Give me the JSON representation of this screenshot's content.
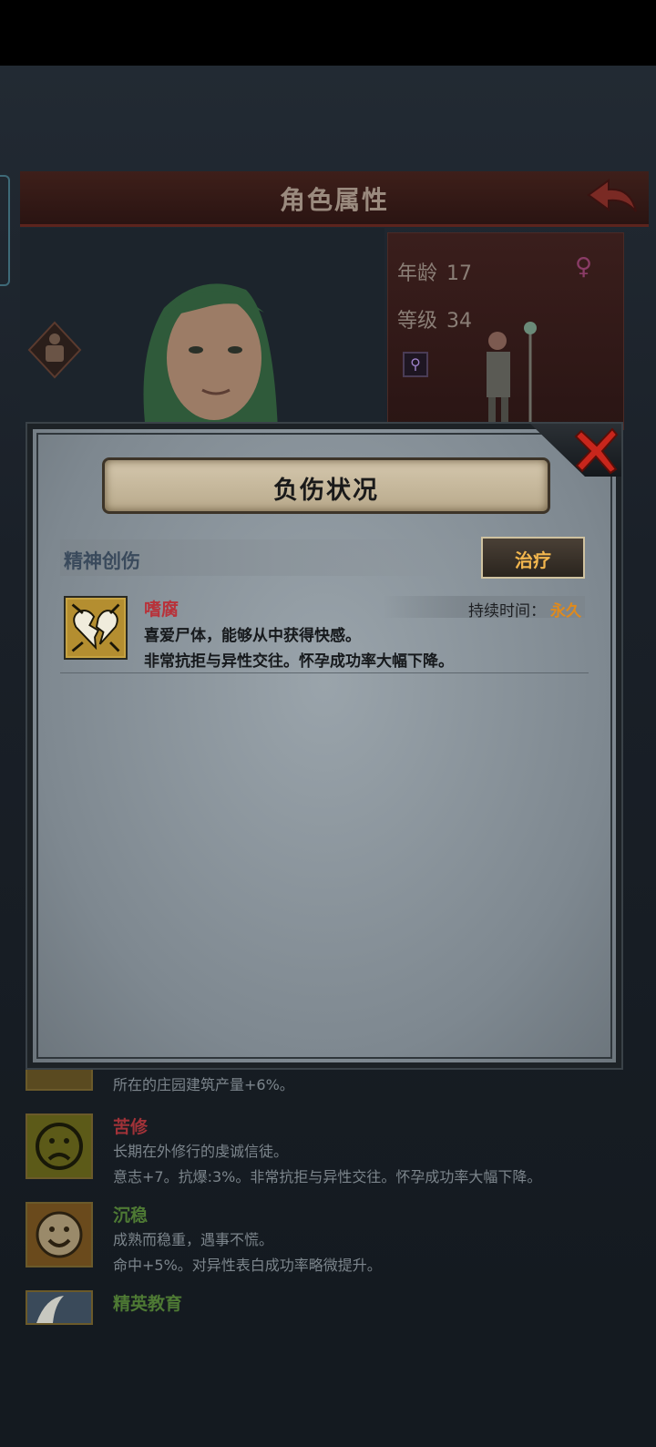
{
  "screen": {
    "title": "角色属性",
    "age_label": "年龄",
    "age_value": "17",
    "level_label": "等级",
    "level_value": "34"
  },
  "dialog": {
    "title": "负伤状况",
    "section_title": "精神创伤",
    "treat_label": "治疗",
    "injury": {
      "name": "嗜腐",
      "icon": "broken-heart-icon",
      "duration_label": "持续时间：",
      "duration_value": "永久",
      "desc_line1": "喜爱尸体，能够从中获得快感。",
      "desc_line2": "非常抗拒与异性交往。怀孕成功率大幅下降。"
    }
  },
  "traits": [
    {
      "name": "",
      "line1": "所在的庄园建筑产量+6%。",
      "line2": "",
      "icon": "trait-icon"
    },
    {
      "name": "苦修",
      "line1": "长期在外修行的虔诚信徒。",
      "line2": "意志+7。抗爆:3%。非常抗拒与异性交往。怀孕成功率大幅下降。",
      "icon": "sad-face-icon",
      "color": "#a03238"
    },
    {
      "name": "沉稳",
      "line1": "成熟而稳重，遇事不慌。",
      "line2": "命中+5%。对异性表白成功率略微提升。",
      "icon": "happy-face-icon",
      "color": "#4e7a34"
    },
    {
      "name": "精英教育",
      "line1": "",
      "line2": "",
      "icon": "book-quill-icon",
      "color": "#4e7a34"
    }
  ],
  "colors": {
    "injury_name": "#b8323a",
    "duration_value": "#e08a1c",
    "treat_label": "#f2b64e"
  }
}
